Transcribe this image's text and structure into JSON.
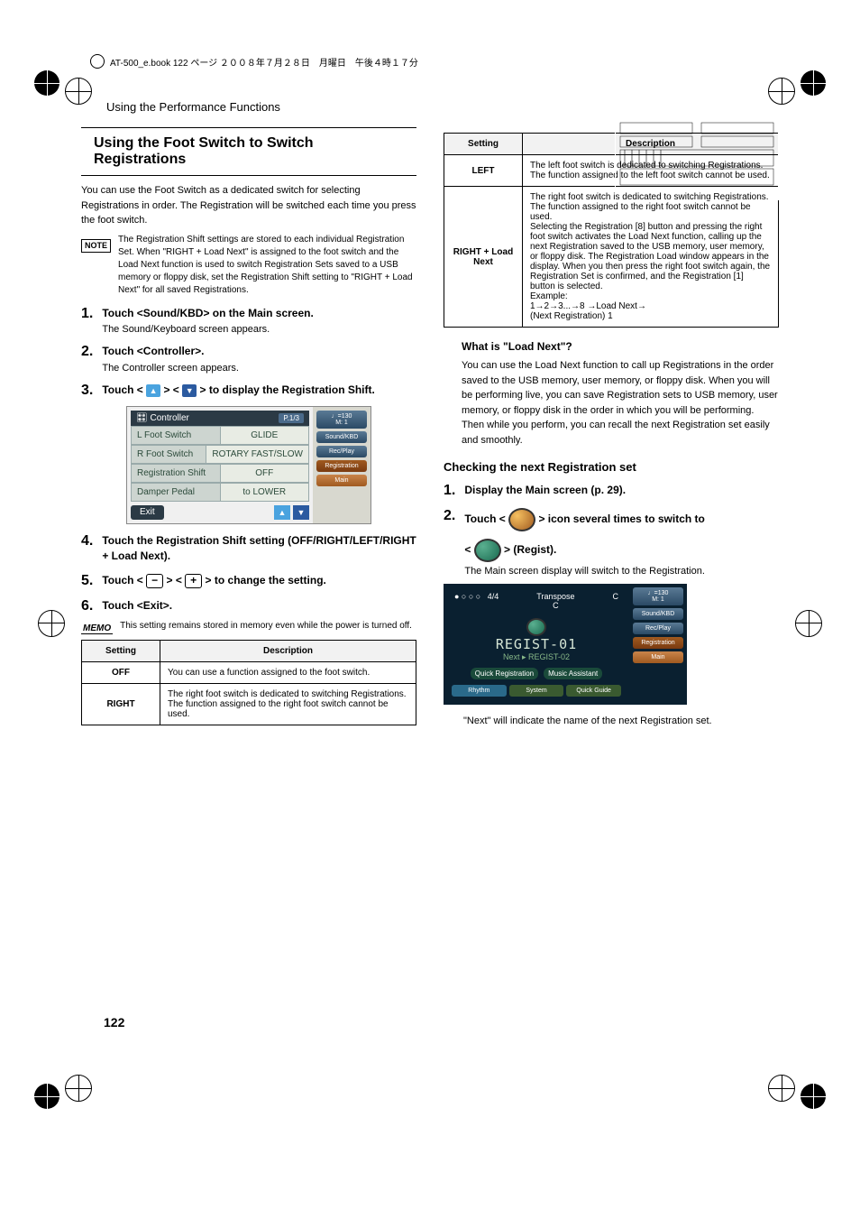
{
  "meta": {
    "header": "AT-500_e.book  122 ページ  ２００８年７月２８日　月曜日　午後４時１７分",
    "section_label": "Using the Performance Functions",
    "page_number": "122"
  },
  "left_col": {
    "title": "Using the Foot Switch to Switch Registrations",
    "intro": "You can use the Foot Switch as a dedicated switch for selecting Registrations in order. The Registration will be switched each time you press the foot switch.",
    "note": "The Registration Shift settings are stored to each individual Registration Set. When \"RIGHT + Load Next\" is assigned to the foot switch and the Load Next function is used to switch Registration Sets saved to a USB memory or floppy disk, set the Registration Shift setting to \"RIGHT + Load Next\" for all saved Registrations.",
    "steps": [
      {
        "num": "1.",
        "title": "Touch <Sound/KBD> on the Main screen.",
        "desc": "The Sound/Keyboard screen appears."
      },
      {
        "num": "2.",
        "title": "Touch <Controller>.",
        "desc": "The Controller screen appears."
      },
      {
        "num": "3.",
        "title_pre": "Touch < ",
        "title_mid": " > < ",
        "title_post": " > to display the Registration Shift.",
        "desc": ""
      },
      {
        "num": "4.",
        "title": "Touch the Registration Shift setting (OFF/RIGHT/LEFT/RIGHT + Load Next).",
        "desc": ""
      },
      {
        "num": "5.",
        "title_pre": "Touch < ",
        "title_mid": " > < ",
        "title_post": " > to change the setting.",
        "desc": ""
      },
      {
        "num": "6.",
        "title": "Touch <Exit>.",
        "desc": ""
      }
    ],
    "memo": "This setting remains stored in memory even while the power is turned off.",
    "table1": {
      "headers": [
        "Setting",
        "Description"
      ],
      "rows": [
        {
          "setting": "OFF",
          "desc": "You can use a function assigned to the foot switch."
        },
        {
          "setting": "RIGHT",
          "desc": "The right foot switch is dedicated to switching Registrations. The function assigned to the right foot switch cannot be used."
        }
      ]
    },
    "controller": {
      "title": "Controller",
      "page_tag": "P.1/3",
      "tempo": "♩=130\nM:   1",
      "rows": [
        {
          "label": "L Foot Switch",
          "value": "GLIDE"
        },
        {
          "label": "R Foot Switch",
          "value": "ROTARY FAST/SLOW"
        },
        {
          "label": "Registration Shift",
          "value": "OFF"
        },
        {
          "label": "Damper Pedal",
          "value": "to LOWER"
        }
      ],
      "side_buttons": [
        "Sound/KBD",
        "Rec/Play",
        "Registration",
        "Main"
      ],
      "exit": "Exit"
    }
  },
  "right_col": {
    "table2": {
      "headers": [
        "Setting",
        "Description"
      ],
      "rows": [
        {
          "setting": "LEFT",
          "desc": "The left foot switch is dedicated to switching Registrations. The function assigned to the left foot switch cannot be used."
        },
        {
          "setting": "RIGHT + Load Next",
          "desc": "The right foot switch is dedicated to switching Registrations. The function assigned to the right foot switch cannot be used.\nSelecting the Registration [8] button and pressing the right foot switch activates the Load Next function, calling up the next Registration saved to the USB memory, user memory, or floppy disk. The Registration Load window appears in the display. When you then press the right foot switch again, the Registration Set is confirmed, and the Registration [1] button is selected.\nExample:\n1→2→3...→8 →Load Next→\n(Next Registration) 1"
        }
      ]
    },
    "load_next_heading": "What is \"Load Next\"?",
    "load_next_body": "You can use the Load Next function to call up Registrations in the order saved to the USB memory, user memory, or floppy disk. When you will be performing live, you can save Registration sets to USB memory, user memory, or floppy disk in the order in which you will be performing. Then while you perform, you can recall the next Registration set easily and smoothly.",
    "check_heading": "Checking the next Registration set",
    "check_steps": [
      {
        "num": "1.",
        "title": "Display the Main screen (p. 29)."
      },
      {
        "num": "2.",
        "title_pre": "Touch < ",
        "title_mid": " > icon several times to switch to",
        "title2_pre": "< ",
        "title2_post": " > (Regist).",
        "desc": "The Main screen display will switch to the Registration."
      }
    ],
    "main_mock": {
      "time_sig": "4/4",
      "transpose": "Transpose\nC",
      "key": "C",
      "tempo": "♩=130\nM:   1",
      "regist": "REGIST-01",
      "next": "Next ▸ REGIST-02",
      "quick": "Quick Registration",
      "music": "Music Assistant",
      "side": [
        "Sound/KBD",
        "Rec/Play",
        "Registration",
        "Main"
      ],
      "bottom": [
        "Rhythm",
        "System",
        "Quick Guide"
      ]
    },
    "final_note": "\"Next\" will indicate the name of the next Registration set."
  }
}
